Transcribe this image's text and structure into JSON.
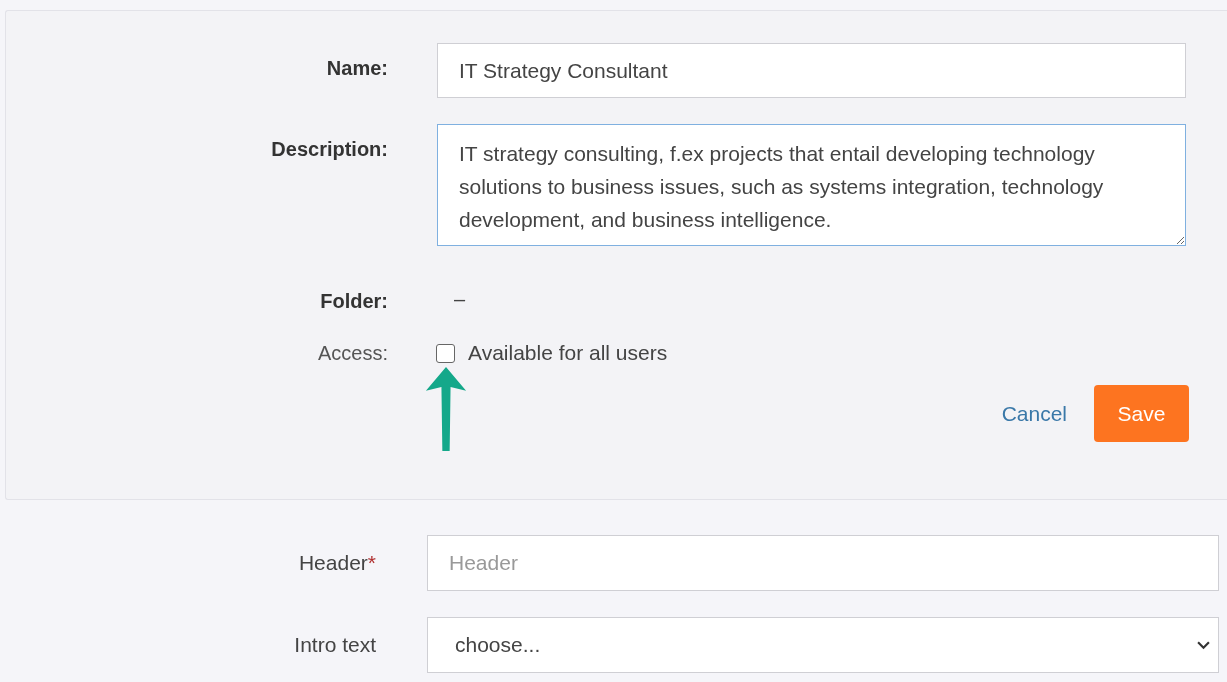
{
  "panel": {
    "name": {
      "label": "Name:",
      "value": "IT Strategy Consultant"
    },
    "description": {
      "label": "Description:",
      "value": "IT strategy consulting, f.ex projects that entail developing technology solutions to business issues, such as systems integration, technology development, and business intelligence."
    },
    "folder": {
      "label": "Folder:",
      "value": "–"
    },
    "access": {
      "label": "Access:",
      "option": "Available for all users",
      "checked": false
    },
    "buttons": [
      {
        "kind": "link",
        "label": "Cancel"
      },
      {
        "kind": "primary",
        "label": "Save"
      }
    ]
  },
  "annotations": [
    {
      "kind": "arrow"
    }
  ],
  "form": [
    {
      "kind": "text",
      "label": "Header",
      "required_mark": "*",
      "placeholder": "Header"
    },
    {
      "kind": "select",
      "label": "Intro text",
      "value": "choose..."
    }
  ]
}
